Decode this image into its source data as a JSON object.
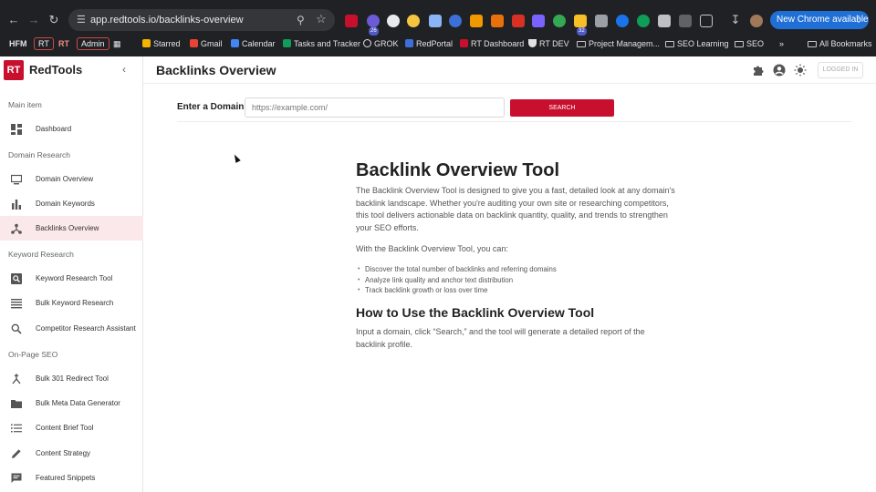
{
  "browser": {
    "url": "app.redtools.io/backlinks-overview",
    "new_chrome_label": "New Chrome available",
    "extension_badges": [
      "26",
      "32"
    ],
    "bookmarks": [
      {
        "label": "HFM",
        "type": "text"
      },
      {
        "label": "RT",
        "type": "box"
      },
      {
        "label": "RT",
        "type": "text"
      },
      {
        "label": "Admin",
        "type": "box"
      },
      {
        "label": "Starred",
        "type": "link"
      },
      {
        "label": "Gmail",
        "type": "link"
      },
      {
        "label": "Calendar",
        "type": "link"
      },
      {
        "label": "Tasks and Tracker",
        "type": "link"
      },
      {
        "label": "GROK",
        "type": "link"
      },
      {
        "label": "RedPortal",
        "type": "link"
      },
      {
        "label": "RT Dashboard",
        "type": "link"
      },
      {
        "label": "RT DEV",
        "type": "link"
      },
      {
        "label": "Project Managem...",
        "type": "folder"
      },
      {
        "label": "SEO Learning",
        "type": "folder"
      },
      {
        "label": "SEO",
        "type": "folder"
      },
      {
        "label": "All Bookmarks",
        "type": "folder"
      }
    ],
    "more_bookmarks": "»"
  },
  "sidebar": {
    "logo_text": "RT",
    "brand": "RedTools",
    "sections": [
      {
        "title": "Main item",
        "items": [
          {
            "label": "Dashboard",
            "icon": "dashboard-icon"
          }
        ]
      },
      {
        "title": "Domain Research",
        "items": [
          {
            "label": "Domain Overview",
            "icon": "monitor-icon"
          },
          {
            "label": "Domain Keywords",
            "icon": "bar-chart-icon"
          },
          {
            "label": "Backlinks Overview",
            "icon": "hub-icon",
            "active": true
          }
        ]
      },
      {
        "title": "Keyword Research",
        "items": [
          {
            "label": "Keyword Research Tool",
            "icon": "search-box-icon"
          },
          {
            "label": "Bulk Keyword Research",
            "icon": "lines-icon"
          },
          {
            "label": "Competitor Research Assistant",
            "icon": "search-icon"
          }
        ]
      },
      {
        "title": "On-Page SEO",
        "items": [
          {
            "label": "Bulk 301 Redirect Tool",
            "icon": "merge-icon"
          },
          {
            "label": "Bulk Meta Data Generator",
            "icon": "folder-icon"
          },
          {
            "label": "Content Brief Tool",
            "icon": "list-icon"
          },
          {
            "label": "Content Strategy",
            "icon": "pencil-icon"
          },
          {
            "label": "Featured Snippets",
            "icon": "comment-icon"
          }
        ]
      }
    ]
  },
  "header": {
    "title": "Backlinks Overview",
    "logged_in": "LOGGED IN"
  },
  "search": {
    "label": "Enter a Domain:",
    "placeholder": "https://example.com/",
    "button": "SEARCH"
  },
  "article": {
    "heading": "Backlink Overview Tool",
    "intro": "The Backlink Overview Tool is designed to give you a fast, detailed look at any domain's backlink landscape. Whether you're auditing your own site or researching competitors, this tool delivers actionable data on backlink quantity, quality, and trends to strengthen your SEO efforts.",
    "lead": "With the Backlink Overview Tool, you can:",
    "bullets": [
      "Discover the total number of backlinks and referring domains",
      "Analyze link quality and anchor text distribution",
      "Track backlink growth or loss over time"
    ],
    "howto_heading": "How to Use the Backlink Overview Tool",
    "howto_text": "Input a domain, click “Search,” and the tool will generate a detailed report of the backlink profile."
  },
  "colors": {
    "brand_red": "#c8102e",
    "active_bg": "#fbe8ea",
    "chrome_dark": "#202124"
  }
}
